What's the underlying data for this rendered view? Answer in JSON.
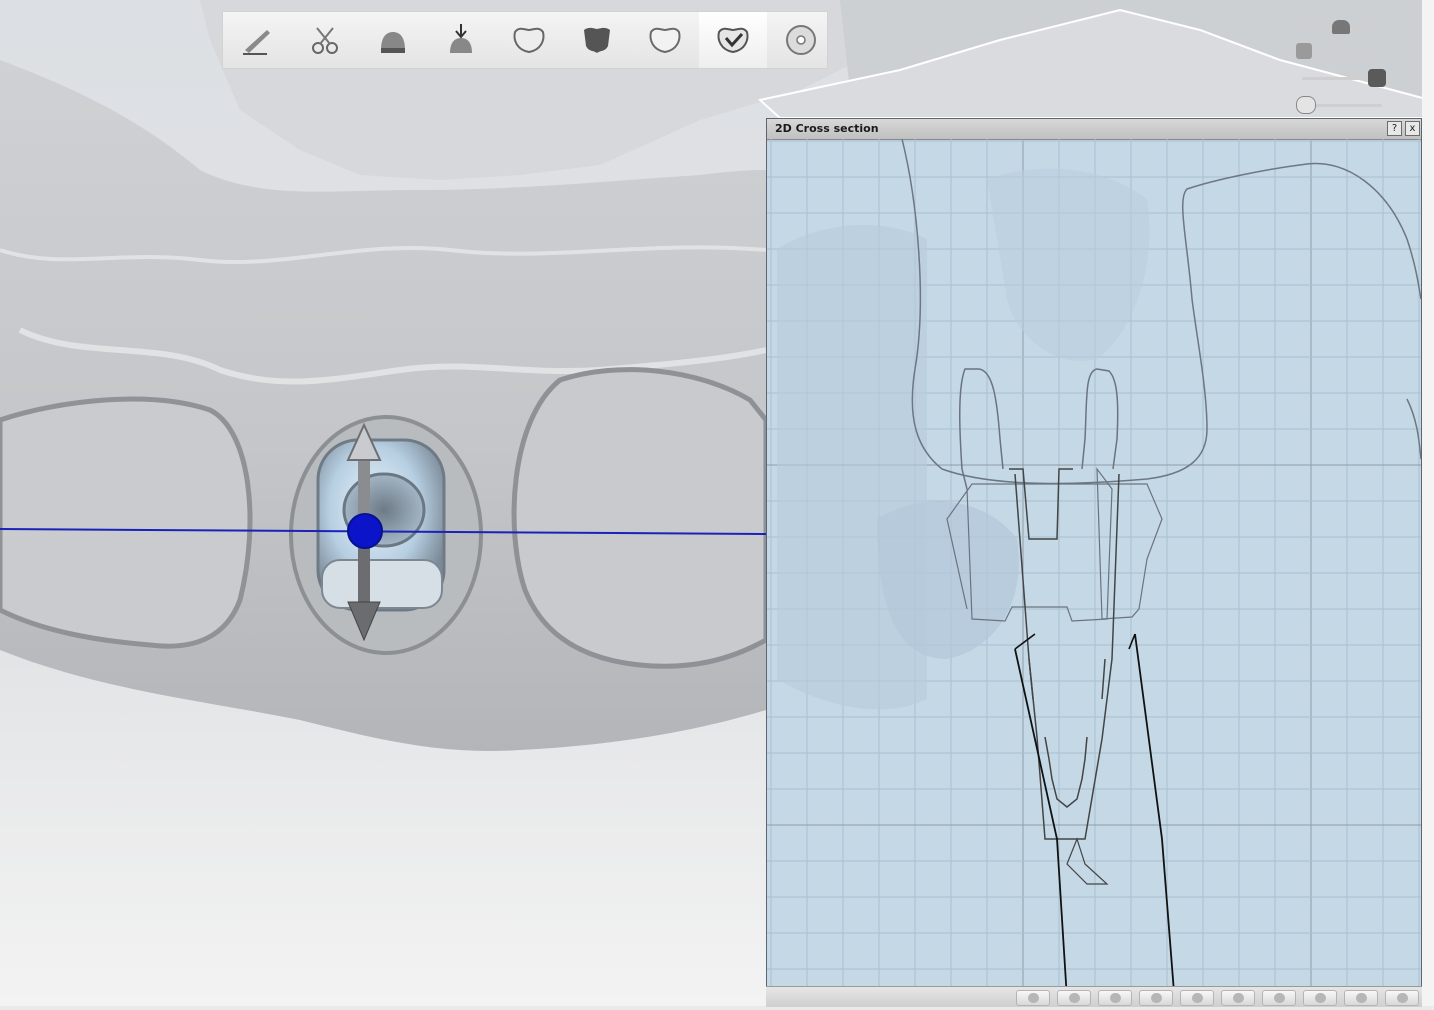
{
  "toolbar": {
    "steps": [
      {
        "icon": "scan-edit-icon"
      },
      {
        "icon": "trim-icon"
      },
      {
        "icon": "abutment-icon"
      },
      {
        "icon": "insertion-direction-icon"
      },
      {
        "icon": "crown-icon"
      },
      {
        "icon": "crown-dark-icon"
      },
      {
        "icon": "crown-shape-icon"
      },
      {
        "icon": "crown-check-icon"
      },
      {
        "icon": "disc-export-icon"
      }
    ],
    "active_step": 7
  },
  "visibility_sliders": [
    {
      "icon": "abutment-visibility-icon",
      "level": 0.55
    },
    {
      "icon": "model-visibility-icon",
      "level": 0.05
    },
    {
      "icon": "crown-visibility-icon",
      "level": 0.95
    },
    {
      "icon": "tooth-visibility-icon",
      "level": 0.05
    }
  ],
  "cross_section": {
    "title": "2D Cross section",
    "help_label": "?",
    "close_label": "x"
  },
  "bottom_toolbar": {
    "buttons": [
      {
        "icon": "crown-view-icon"
      },
      {
        "icon": "target-view-icon"
      },
      {
        "icon": "sphere-view-icon"
      },
      {
        "icon": "tooth-view-icon"
      },
      {
        "icon": "occlusal-view-icon"
      },
      {
        "icon": "lateral-view-icon"
      },
      {
        "icon": "model-view-icon"
      },
      {
        "icon": "contact-view-icon"
      },
      {
        "icon": "clip-view-icon"
      },
      {
        "icon": "cross-section-toggle-icon"
      }
    ]
  },
  "colors": {
    "section_line": "#1a22b8",
    "panel_bg": "#c5d8e6",
    "grid": "#a9bfcf"
  }
}
